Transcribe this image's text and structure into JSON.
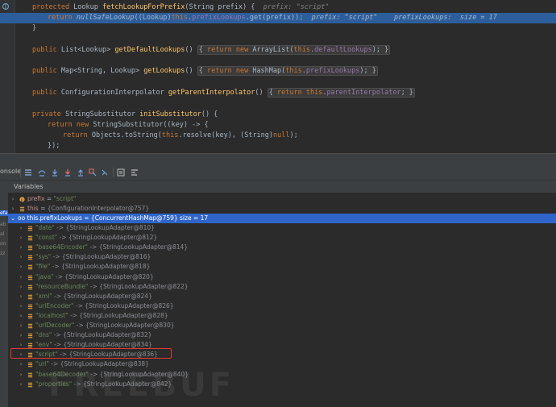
{
  "editor": {
    "lines": {
      "l1": {
        "kw": "protected",
        "type": " Lookup ",
        "fn": "fetchLookupForPrefix",
        "rest": "(String prefix) {",
        "hint": "prefix: \"script\""
      },
      "l2": {
        "kw": "return",
        "sp": " ",
        "call": "nullSafeLookup",
        "open": "((Lookup)",
        "this": "this",
        "dot": ".",
        "field": "prefixLookups",
        "tail": ".get(prefix));",
        "hint": "prefix: \"script\"    prefixLookups:  size = 17"
      },
      "l3": {
        "text": "}"
      },
      "l4": {
        "kw": "public",
        "type": " List<Lookup> ",
        "fn": "getDefaultLookups",
        "p": "()",
        "fold_kw1": "return",
        "fold_kw2": "new",
        "fold_mid": " ArrayList(",
        "fold_this": "this",
        "fold_dot": ".",
        "fold_field": "defaultLookups",
        "fold_end": "); }"
      },
      "l5": {
        "kw": "public",
        "type": " Map<String, Lookup> ",
        "fn": "getLookups",
        "p": "()",
        "fold_kw1": "return",
        "fold_kw2": "new",
        "fold_mid": " HashMap(",
        "fold_this": "this",
        "fold_dot": ".",
        "fold_field": "prefixLookups",
        "fold_end": "); }"
      },
      "l6": {
        "kw": "public",
        "type": " ConfigurationInterpolator ",
        "fn": "getParentInterpolator",
        "p": "()",
        "fold_kw1": "return",
        "fold_this": "this",
        "fold_dot": ".",
        "fold_field": "parentInterpolator",
        "fold_end": "; }"
      },
      "l7": {
        "kw": "private",
        "type": " StringSubstitutor ",
        "fn": "initSubstitutor",
        "rest": "() {"
      },
      "l8": {
        "kw": "return",
        "kw2": "new",
        "rest": " StringSubstitutor((key) -> {"
      },
      "l9": {
        "kw": "return",
        "rest1": " Objects.toString(",
        "this": "this",
        "rest2": ".resolve(key), (String)",
        "kw2": "null",
        "rest3": ");"
      },
      "l10": {
        "text": "});"
      }
    }
  },
  "toolbar": {
    "console_label": "onsole"
  },
  "variables": {
    "title": "Variables",
    "left_strip": [
      "efa",
      "ab",
      "al",
      "on",
      "zz"
    ],
    "rows": {
      "r0": {
        "name": "prefix",
        "eq": " = ",
        "value": "\"script\""
      },
      "r1": {
        "name": "this",
        "eq": " = ",
        "value": "{ConfigurationInterpolator@757}"
      },
      "r2": {
        "prefix": "oo ",
        "name": "this.prefixLookups",
        "eq": " = ",
        "value": "{ConcurrentHashMap@759}  size = 17"
      },
      "entries": [
        {
          "key": "\"date\"",
          "value": " -> {StringLookupAdapter@810}"
        },
        {
          "key": "\"const\"",
          "value": " -> {StringLookupAdapter@812}"
        },
        {
          "key": "\"base64Encoder\"",
          "value": " -> {StringLookupAdapter@814}"
        },
        {
          "key": "\"sys\"",
          "value": " -> {StringLookupAdapter@816}"
        },
        {
          "key": "\"file\"",
          "value": " -> {StringLookupAdapter@818}"
        },
        {
          "key": "\"java\"",
          "value": " -> {StringLookupAdapter@820}"
        },
        {
          "key": "\"resourceBundle\"",
          "value": " -> {StringLookupAdapter@822}"
        },
        {
          "key": "\"xml\"",
          "value": " -> {StringLookupAdapter@824}"
        },
        {
          "key": "\"urlEncoder\"",
          "value": " -> {StringLookupAdapter@826}"
        },
        {
          "key": "\"localhost\"",
          "value": " -> {StringLookupAdapter@828}"
        },
        {
          "key": "\"urlDecoder\"",
          "value": " -> {StringLookupAdapter@830}"
        },
        {
          "key": "\"dns\"",
          "value": " -> {StringLookupAdapter@832}"
        },
        {
          "key": "\"env\"",
          "value": " -> {StringLookupAdapter@834}"
        },
        {
          "key": "\"script\"",
          "value": " -> {StringLookupAdapter@836}"
        },
        {
          "key": "\"url\"",
          "value": " -> {StringLookupAdapter@838}"
        },
        {
          "key": "\"base64Decoder\"",
          "value": " -> {StringLookupAdapter@840}"
        },
        {
          "key": "\"properties\"",
          "value": " -> {StringLookupAdapter@842}"
        }
      ]
    }
  },
  "watermark": "FREEBUF",
  "colors": {
    "selection": "#2f65ca",
    "execution_line": "#2d5e9c",
    "highlight_box": "#e53935"
  }
}
